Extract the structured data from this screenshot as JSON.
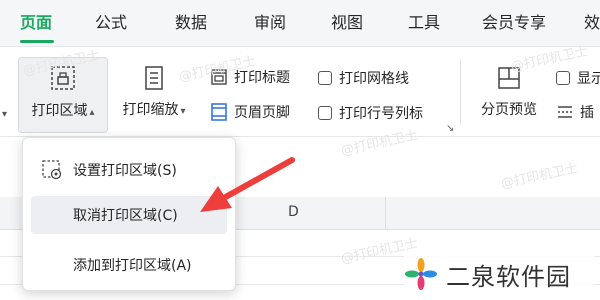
{
  "tabs": [
    {
      "label": "页面",
      "active": true
    },
    {
      "label": "公式"
    },
    {
      "label": "数据"
    },
    {
      "label": "审阅"
    },
    {
      "label": "视图"
    },
    {
      "label": "工具"
    },
    {
      "label": "会员专享"
    },
    {
      "label": "效"
    }
  ],
  "toolbar": {
    "print_area": "打印区域",
    "print_scale": "打印缩放",
    "print_titles": "打印标题",
    "header_footer": "页眉页脚",
    "print_gridlines": "打印网格线",
    "print_row_col_headers": "打印行号列标",
    "page_break_preview": "分页预览",
    "show_partial": "显示",
    "insert_partial": "插"
  },
  "dropdown": {
    "items": [
      {
        "label": "设置打印区域(S)",
        "icon": "print-area-set-icon"
      },
      {
        "label": "取消打印区域(C)",
        "hover": true
      },
      {
        "label": "添加到打印区域(A)"
      }
    ]
  },
  "grid": {
    "column_d": "D"
  },
  "watermark_text": "@打印机卫士",
  "brand": {
    "name": "二泉软件园"
  },
  "colors": {
    "accent": "#1aa860",
    "arrow": "#ee3e3b"
  }
}
